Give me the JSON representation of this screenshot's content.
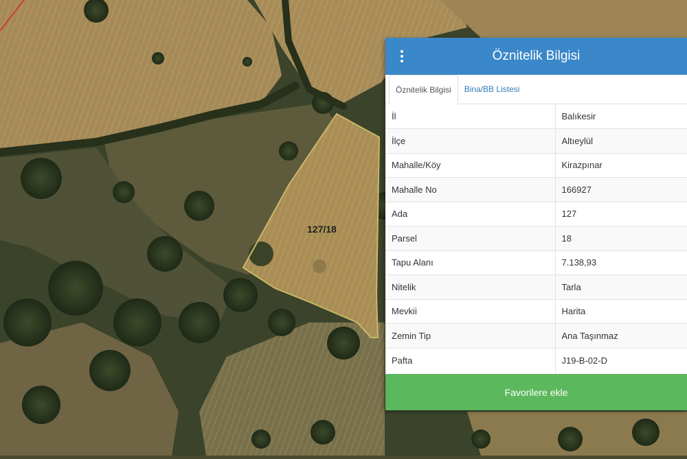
{
  "map": {
    "parcel_label": "127/18",
    "colors": {
      "parcel_outline": "#c9b96a",
      "boundary_line": "#d23a3a"
    }
  },
  "panel": {
    "title": "Öznitelik Bilgisi",
    "menu_icon": "vertical-dots-icon",
    "header_color": "#3a87c9",
    "tabs": [
      {
        "label": "Öznitelik Bilgisi",
        "active": true
      },
      {
        "label": "Bina/BB Listesi",
        "active": false
      }
    ],
    "rows": [
      {
        "key": "İl",
        "value": "Balıkesir"
      },
      {
        "key": "İlçe",
        "value": "Altıeylül"
      },
      {
        "key": "Mahalle/Köy",
        "value": "Kirazpınar"
      },
      {
        "key": "Mahalle No",
        "value": "166927"
      },
      {
        "key": "Ada",
        "value": "127"
      },
      {
        "key": "Parsel",
        "value": "18"
      },
      {
        "key": "Tapu Alanı",
        "value": "7.138,93"
      },
      {
        "key": "Nitelik",
        "value": "Tarla"
      },
      {
        "key": "Mevkii",
        "value": "Harita"
      },
      {
        "key": "Zemin Tip",
        "value": "Ana Taşınmaz"
      },
      {
        "key": "Pafta",
        "value": "J19-B-02-D"
      }
    ],
    "favorite_button": "Favorilere ekle",
    "favorite_color": "#5cb85c"
  }
}
